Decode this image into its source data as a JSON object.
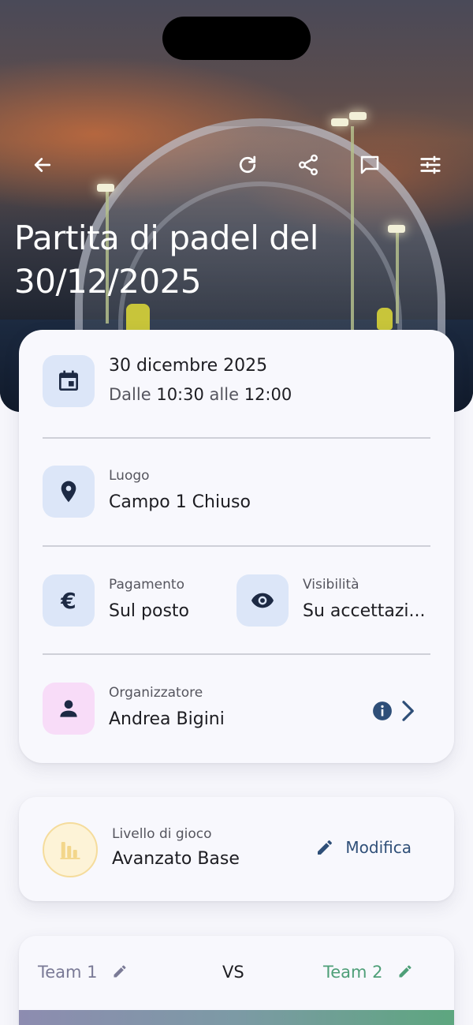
{
  "header": {
    "title": "Partita di padel del 30/12/2025",
    "back_icon": "arrow-left-icon",
    "actions": [
      "refresh-icon",
      "share-icon",
      "chat-icon",
      "tune-icon"
    ]
  },
  "details": {
    "date": {
      "line1": "30 dicembre 2025",
      "line2_prefix": "Dalle",
      "start": "10:30",
      "line2_mid": "alle",
      "end": "12:00"
    },
    "location": {
      "caption": "Luogo",
      "value": "Campo 1 Chiuso"
    },
    "payment": {
      "caption": "Pagamento",
      "value": "Sul posto"
    },
    "visibility": {
      "caption": "Visibilità",
      "value": "Su accettazi..."
    },
    "organizer": {
      "caption": "Organizzatore",
      "value": "Andrea Bigini"
    }
  },
  "level": {
    "caption": "Livello di gioco",
    "value": "Avanzato Base",
    "edit_label": "Modifica"
  },
  "teams": {
    "team1": "Team 1",
    "vs": "VS",
    "team2": "Team 2"
  },
  "colors": {
    "accent_blue": "#2f4f78",
    "team1": "#7a7a96",
    "team2": "#4e9f78",
    "icon_bg_blue": "#dce6f8",
    "icon_bg_pink": "#f8dcf8"
  }
}
